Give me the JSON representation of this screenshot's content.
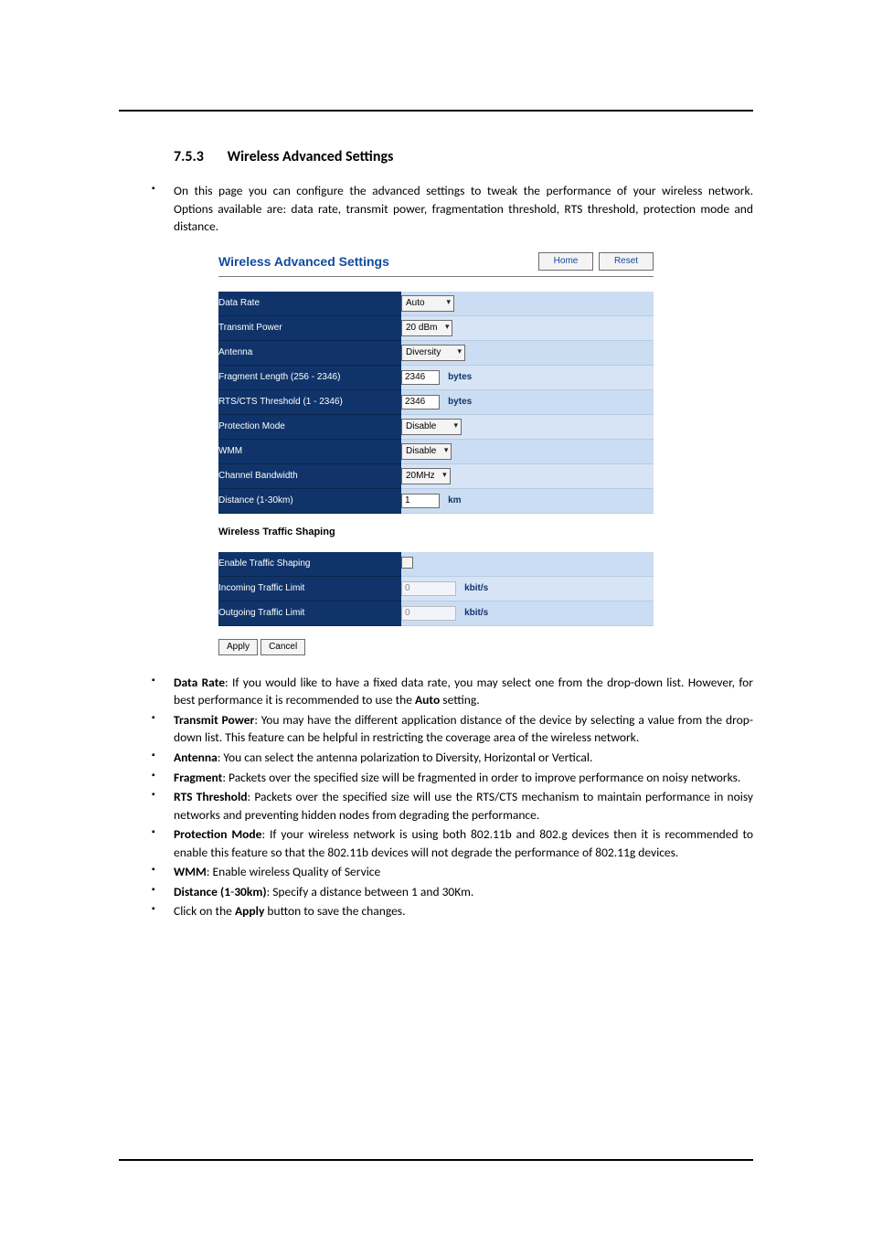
{
  "heading": {
    "number": "7.5.3",
    "title": "Wireless Advanced Settings"
  },
  "intro": "On this page you can configure the advanced settings to tweak the performance of your wireless network. Options available are: data rate, transmit power, fragmentation threshold, RTS threshold, protection mode and distance.",
  "panel": {
    "title": "Wireless Advanced Settings",
    "home_btn": "Home",
    "reset_btn": "Reset",
    "rows": {
      "data_rate": {
        "label": "Data Rate",
        "value": "Auto"
      },
      "transmit_power": {
        "label": "Transmit Power",
        "value": "20 dBm"
      },
      "antenna": {
        "label": "Antenna",
        "value": "Diversity"
      },
      "fragment": {
        "label": "Fragment Length (256 - 2346)",
        "value": "2346",
        "unit": "bytes"
      },
      "rts": {
        "label": "RTS/CTS Threshold (1 - 2346)",
        "value": "2346",
        "unit": "bytes"
      },
      "protection": {
        "label": "Protection Mode",
        "value": "Disable"
      },
      "wmm": {
        "label": "WMM",
        "value": "Disable"
      },
      "channel_bw": {
        "label": "Channel Bandwidth",
        "value": "20MHz"
      },
      "distance": {
        "label": "Distance (1-30km)",
        "value": "1",
        "unit": "km"
      }
    },
    "shaping_head": "Wireless Traffic Shaping",
    "shaping": {
      "enable": {
        "label": "Enable Traffic Shaping"
      },
      "incoming": {
        "label": "Incoming Traffic Limit",
        "value": "0",
        "unit": "kbit/s"
      },
      "outgoing": {
        "label": "Outgoing Traffic Limit",
        "value": "0",
        "unit": "kbit/s"
      }
    },
    "apply_btn": "Apply",
    "cancel_btn": "Cancel"
  },
  "bullets": {
    "b1_lead": "Data Rate",
    "b1_rest": ": If you would like to have a fixed data rate, you may select one from the drop-down list. However, for best performance it is recommended to use the ",
    "b1_bold2": "Auto",
    "b1_tail": " setting.",
    "b2_lead": "Transmit Power",
    "b2_rest": ": You may have the different application distance of the device by selecting a value from the drop-down list. This feature can be helpful in restricting the coverage area of the wireless network.",
    "b3_lead": "Antenna",
    "b3_rest": ": You can select the antenna polarization to Diversity, Horizontal or Vertical.",
    "b4_lead": "Fragment",
    "b4_rest": ": Packets over the specified size will be fragmented in order to improve performance on noisy networks.",
    "b5_lead": "RTS Threshold",
    "b5_rest": ": Packets over the specified size will use the RTS/CTS mechanism to maintain performance in noisy networks and preventing hidden nodes from degrading the performance.",
    "b6_lead": "Protection Mode",
    "b6_rest": ": If your wireless network is using both 802.11b and 802.g devices then it is recommended to enable this feature so that the 802.11b devices will not degrade the performance of 802.11g devices.",
    "b7_lead": "WMM",
    "b7_rest": ": Enable wireless Quality of Service",
    "b8_lead": "Distance (1",
    "b8_dash": "-",
    "b8_lead2": "30km)",
    "b8_rest": ": Specify a distance between 1 and 30Km.",
    "b9_pre": "Click on the ",
    "b9_bold": "Apply",
    "b9_post": " button to save the changes."
  }
}
